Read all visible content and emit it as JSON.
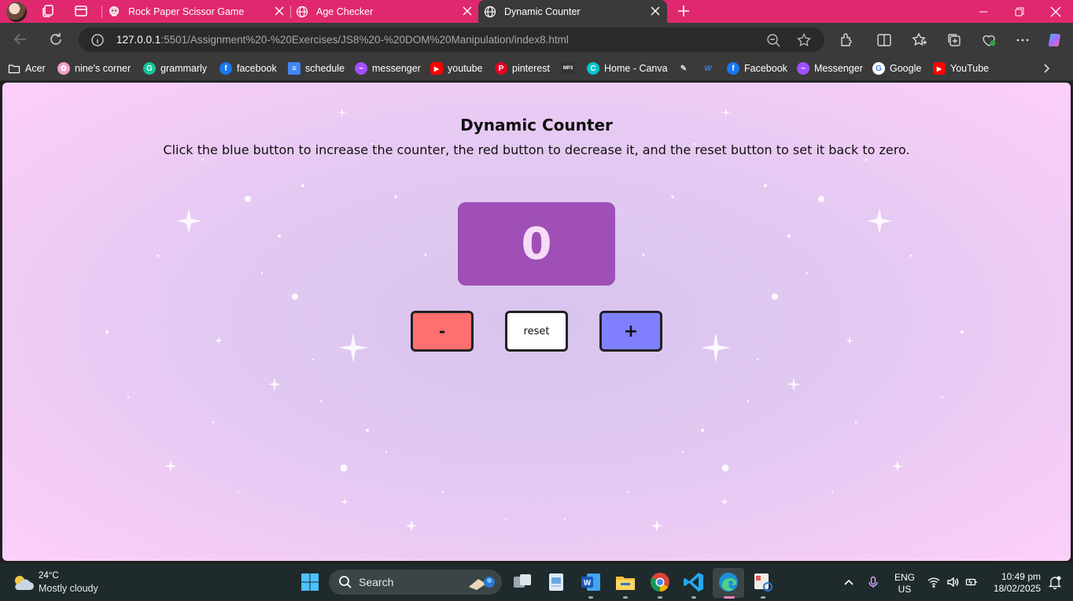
{
  "browser": {
    "tabs": [
      {
        "title": "Rock Paper Scissor Game",
        "icon": "game-icon",
        "active": false
      },
      {
        "title": "Age Checker",
        "icon": "globe-icon",
        "active": false
      },
      {
        "title": "Dynamic Counter",
        "icon": "globe-icon",
        "active": true
      }
    ],
    "address": {
      "host": "127.0.0.1",
      "rest": ":5501/Assignment%20-%20Exercises/JS8%20-%20DOM%20Manipulation/index8.html"
    },
    "bookmarks": [
      {
        "label": "Acer",
        "icon": "folder-icon",
        "color": "#ffffff"
      },
      {
        "label": "nine's corner",
        "icon": "flower-icon",
        "color": "#f2a0c8"
      },
      {
        "label": "grammarly",
        "icon": "grammarly-icon",
        "color": "#15c39a"
      },
      {
        "label": "facebook",
        "icon": "facebook-icon",
        "color": "#1877f2"
      },
      {
        "label": "schedule",
        "icon": "docs-icon",
        "color": "#4285f4"
      },
      {
        "label": "messenger",
        "icon": "messenger-icon",
        "color": "#a050ff"
      },
      {
        "label": "youtube",
        "icon": "youtube-icon",
        "color": "#ff0000"
      },
      {
        "label": "pinterest",
        "icon": "pinterest-icon",
        "color": "#e60023"
      },
      {
        "label": "",
        "icon": "mp3-icon",
        "color": "#333333"
      },
      {
        "label": "Home - Canva",
        "icon": "canva-icon",
        "color": "#00c4cc"
      },
      {
        "label": "",
        "icon": "quill-icon",
        "color": "#dddddd"
      },
      {
        "label": "",
        "icon": "w-logo-icon",
        "color": "#3b7dd8"
      },
      {
        "label": "Facebook",
        "icon": "facebook-icon",
        "color": "#1877f2"
      },
      {
        "label": "Messenger",
        "icon": "messenger-icon",
        "color": "#a050ff"
      },
      {
        "label": "Google",
        "icon": "google-icon",
        "color": "#ffffff"
      },
      {
        "label": "YouTube",
        "icon": "youtube-icon",
        "color": "#ff0000"
      }
    ]
  },
  "page": {
    "title": "Dynamic Counter",
    "description": "Click the blue button to increase the counter, the red button to decrease it, and the reset button to set it back to zero.",
    "counter_value": "0",
    "buttons": {
      "minus": "-",
      "reset": "reset",
      "plus": "+"
    },
    "colors": {
      "counter_bg": "#9f4fb6",
      "minus_bg": "#ff6f6f",
      "plus_bg": "#8080ff",
      "reset_bg": "#ffffff"
    }
  },
  "taskbar": {
    "weather": {
      "temp": "24°C",
      "condition": "Mostly cloudy"
    },
    "search_label": "Search",
    "lang": {
      "line1": "ENG",
      "line2": "US"
    },
    "clock": {
      "time": "10:49 pm",
      "date": "18/02/2025"
    }
  }
}
